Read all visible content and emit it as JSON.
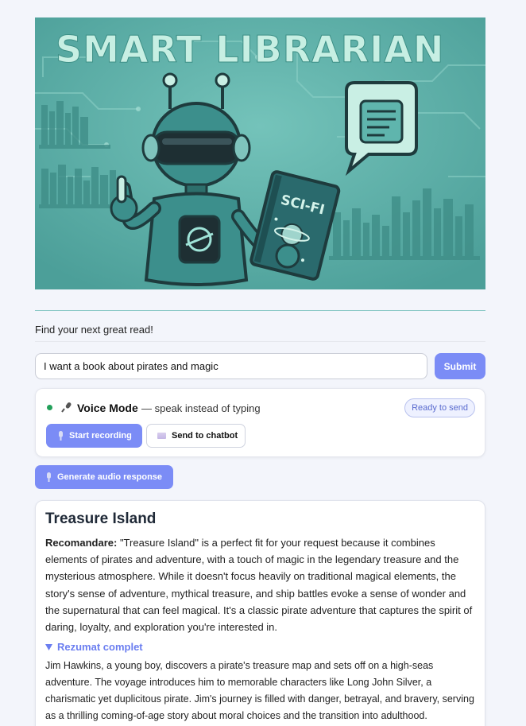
{
  "banner": {
    "title": "SMART LIBRARIAN",
    "book_label": "SCI-FI"
  },
  "tagline": "Find your next great read!",
  "search": {
    "value": "I want a book about pirates and magic",
    "submit_label": "Submit"
  },
  "voice": {
    "title": "Voice Mode",
    "subtitle": "— speak instead of typing",
    "status": "Ready to send",
    "start_label": "Start recording",
    "send_label": "Send to chatbot"
  },
  "generate_audio_label": "Generate audio response",
  "result": {
    "title": "Treasure Island",
    "recommendation_label": "Recomandare:",
    "recommendation_text": "\"Treasure Island\" is a perfect fit for your request because it combines elements of pirates and adventure, with a touch of magic in the legendary treasure and the mysterious atmosphere. While it doesn't focus heavily on traditional magical elements, the story's sense of adventure, mythical treasure, and ship battles evoke a sense of wonder and the supernatural that can feel magical. It's a classic pirate adventure that captures the spirit of daring, loyalty, and exploration you're interested in.",
    "summary_toggle": "Rezumat complet",
    "summary_text": "Jim Hawkins, a young boy, discovers a pirate's treasure map and sets off on a high-seas adventure. The voyage introduces him to memorable characters like Long John Silver, a charismatic yet duplicitous pirate. Jim's journey is filled with danger, betrayal, and bravery, serving as a thrilling coming-of-age story about moral choices and the transition into adulthood."
  },
  "colors": {
    "accent": "#7b8cf6",
    "status_green": "#22a05a",
    "banner_teal": "#5fb5ad"
  }
}
